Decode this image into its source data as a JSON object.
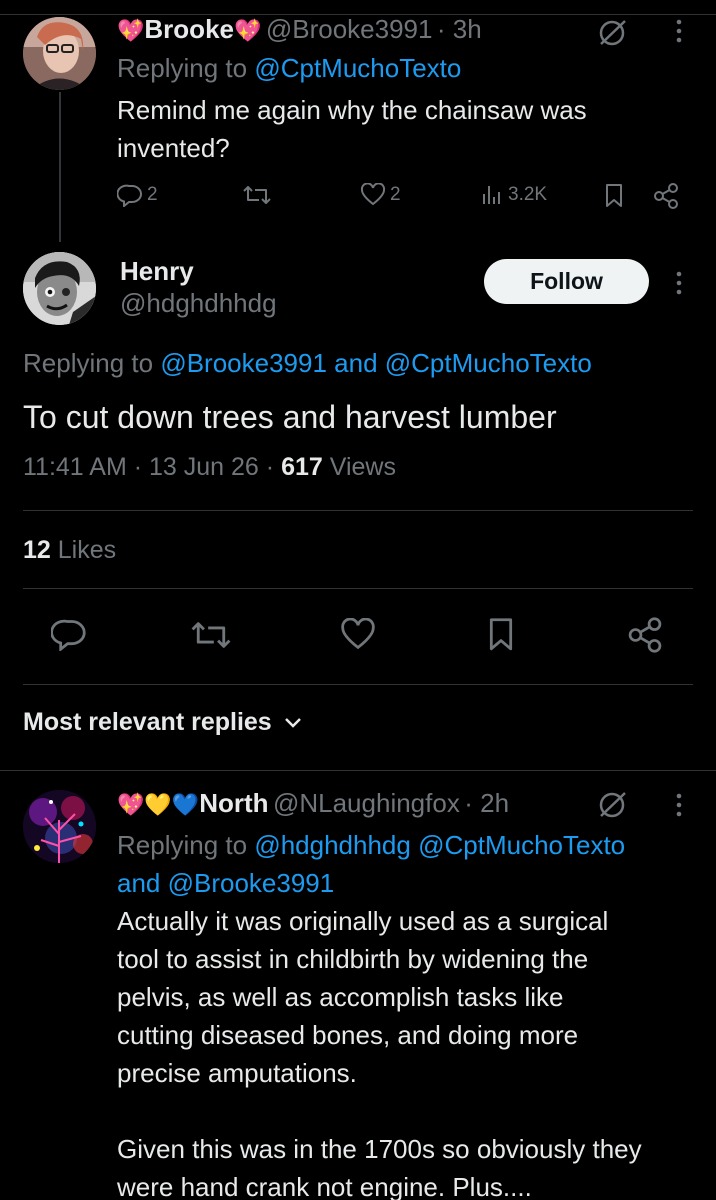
{
  "reply1": {
    "name": "Brooke",
    "emoji_left": "💖",
    "emoji_right": "💖",
    "handle": "@Brooke3991",
    "time": "· 3h",
    "replying_prefix": "Replying to ",
    "replying_to": "@CptMuchoTexto",
    "text_line1": "Remind me again why the chainsaw was",
    "text_line2": "invented?",
    "replies": "2",
    "likes": "2",
    "views": "3.2K"
  },
  "main": {
    "name": "Henry",
    "handle": "@hdghdhhdg",
    "follow_label": "Follow",
    "replying_prefix": "Replying to ",
    "replying_to_1": "@Brooke3991",
    "replying_and": " and ",
    "replying_to_2": "@CptMuchoTexto",
    "text": "To cut down trees and harvest lumber",
    "time": "11:41 AM",
    "date": "13 Jun 26",
    "views_count": "617",
    "views_label": "Views",
    "likes_count": "12",
    "likes_label": "Likes"
  },
  "sort": {
    "label": "Most relevant replies"
  },
  "reply2": {
    "emojis": "💖💛💙",
    "name": "North",
    "handle": "@NLaughingfox",
    "time": "· 2h",
    "replying_prefix": "Replying to ",
    "replying_to_1": "@hdghdhhdg",
    "replying_to_2": "@CptMuchoTexto",
    "replying_and": "and ",
    "replying_to_3": "@Brooke3991",
    "p1_line1": "Actually it was originally used as a surgical",
    "p1_line2": "tool to assist in childbirth by widening the",
    "p1_line3": "pelvis, as well as accomplish tasks like",
    "p1_line4": "cutting diseased bones, and doing more",
    "p1_line5": "precise amputations.",
    "p2_line1": "Given this was in the 1700s so obviously they",
    "p2_line2": "were hand crank not engine. Plus...."
  },
  "colors": {
    "background": "#000000",
    "text": "#e7e9ea",
    "muted": "#71767b",
    "link": "#1d9bf0",
    "follow_bg": "#eff3f4"
  },
  "icons": [
    "reply-icon",
    "retweet-icon",
    "heart-icon",
    "views-icon",
    "bookmark-icon",
    "share-icon",
    "grok-icon",
    "more-icon",
    "chevron-down-icon"
  ]
}
